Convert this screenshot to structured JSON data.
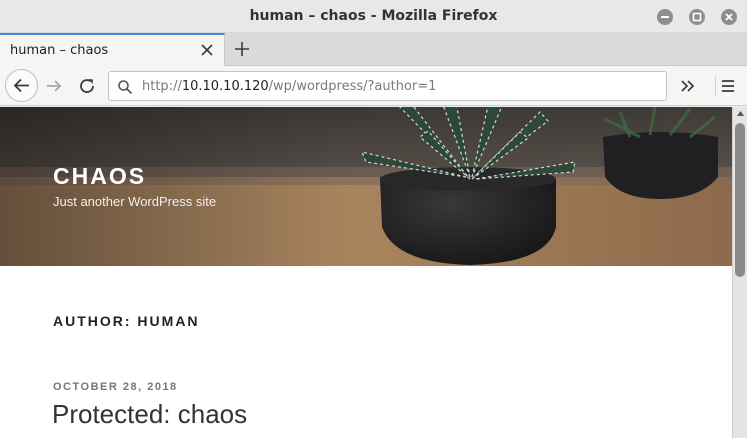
{
  "window": {
    "title": "human – chaos - Mozilla Firefox"
  },
  "tabs": [
    {
      "label": "human – chaos",
      "active": true
    }
  ],
  "navbar": {
    "url_prefix": "http://",
    "url_host": "10.10.10.120",
    "url_path": "/wp/wordpress/?author=1"
  },
  "site": {
    "title": "CHAOS",
    "description": "Just another WordPress site"
  },
  "archive": {
    "title": "AUTHOR: HUMAN"
  },
  "post": {
    "date": "OCTOBER 28, 2018",
    "title": "Protected: chaos"
  },
  "colors": {
    "tab_accent": "#3d8de0",
    "window_control": "#8a8e8f"
  },
  "icons": {
    "minimize": "minimize-icon",
    "maximize": "maximize-icon",
    "close": "close-icon",
    "back": "back-arrow-icon",
    "forward": "forward-arrow-icon",
    "reload": "reload-icon",
    "search": "search-icon",
    "overflow": "overflow-chevrons-icon",
    "menu": "hamburger-menu-icon"
  }
}
